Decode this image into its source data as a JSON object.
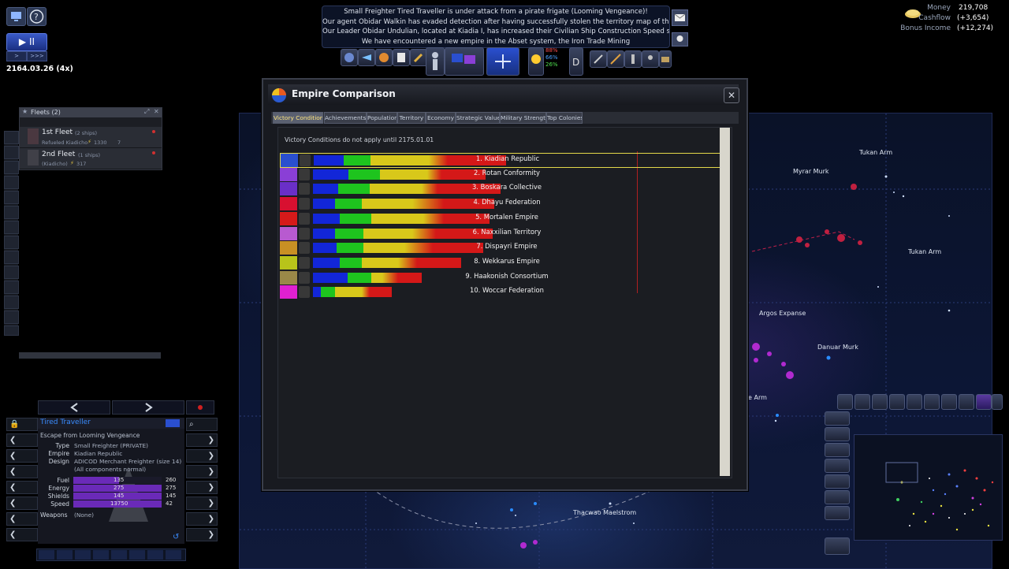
{
  "game": {
    "date": "2164.03.26 (4x)",
    "speed_play_label": "▶",
    "speed_pause_label": "II",
    "speed_prev_label": ">",
    "speed_next_label": ">>>"
  },
  "messages": [
    "Small Freighter Tired Traveller is under attack from a pirate frigate (Looming Vengeance)!",
    "Our agent Obidar Walkin has evaded detection after having successfully stolen the territory map of the Re",
    "Our Leader Obidar Undulian, located at Kiadia I, has increased their Civilian Ship Construction Speed skill leve",
    "We have encountered a new empire in the Abset system, the Iron Trade Mining"
  ],
  "finance": {
    "money_label": "Money",
    "money_value": "219,708",
    "cashflow_label": "Cashflow",
    "cashflow_value": "(+3,654)",
    "bonus_label": "Bonus Income",
    "bonus_value": "(+12,274)"
  },
  "toolbar": {
    "pct1": "88%",
    "pct2": "66%",
    "pct3": "26%"
  },
  "dialog": {
    "title": "Empire Comparison",
    "close_label": "✕",
    "tabs": [
      "Victory Conditions",
      "Achievements",
      "Population",
      "Territory",
      "Economy",
      "Strategic Value",
      "Military Strength",
      "Top Colonies"
    ],
    "active_tab": "Victory Conditions",
    "notice": "Victory Conditions do not apply until 2175.01.01",
    "empires": [
      {
        "name": "1. Kiadian Republic",
        "flag": "#2a4fcf",
        "bars": [
          38,
          34,
          30,
          44,
          24,
          74
        ],
        "selected": true
      },
      {
        "name": "2. Rotan Conformity",
        "flag": "#8a3fd6",
        "bars": [
          45,
          40,
          34,
          26,
          18,
          56
        ]
      },
      {
        "name": "3. Boskara Collective",
        "flag": "#6a2fc8",
        "bars": [
          32,
          40,
          36,
          30,
          20,
          80
        ]
      },
      {
        "name": "4. Dhayu Federation",
        "flag": "#d81030",
        "bars": [
          28,
          34,
          28,
          36,
          40,
          64
        ]
      },
      {
        "name": "5. Mortalen Empire",
        "flag": "#d61a1a",
        "bars": [
          34,
          40,
          40,
          26,
          26,
          58
        ]
      },
      {
        "name": "6. Naxxilian Territory",
        "flag": "#b85ad0",
        "bars": [
          28,
          36,
          30,
          32,
          30,
          72
        ]
      },
      {
        "name": "7. Dispayri Empire",
        "flag": "#c89024",
        "bars": [
          30,
          34,
          30,
          22,
          36,
          64
        ]
      },
      {
        "name": "8. Wekkarus Empire",
        "flag": "#b8c41a",
        "bars": [
          34,
          28,
          24,
          22,
          24,
          56
        ]
      },
      {
        "name": "9. Haakonish Consortium",
        "flag": "#9a8848",
        "bars": [
          44,
          30,
          8,
          6,
          20,
          30
        ]
      },
      {
        "name": "10. Woccar Federation",
        "flag": "#e020d0",
        "bars": [
          10,
          18,
          0,
          34,
          10,
          28
        ]
      }
    ]
  },
  "fleets": {
    "header": "Fleets (2)",
    "items": [
      {
        "name": "1st Fleet",
        "ships": "(2 ships)",
        "status": "Refueled Kiadicho",
        "fuel": "1330",
        "count": "7"
      },
      {
        "name": "2nd Fleet",
        "ships": "(1 ships)",
        "status": "(Kiadicho)",
        "fuel": "317",
        "count": ""
      }
    ]
  },
  "ship": {
    "name": "Tired Traveller",
    "mission": "Escape from Looming Vengeance",
    "type_label": "Type",
    "type_value": "Small Freighter (PRIVATE)",
    "empire_label": "Empire",
    "empire_value": "Kiadian Republic",
    "design_label": "Design",
    "design_value": "ADICOD Merchant Freighter (size 14)",
    "design_note": "(All components normal)",
    "stats": [
      {
        "label": "Fuel",
        "value": "135",
        "max": "260",
        "fraction": 0.52
      },
      {
        "label": "Energy",
        "value": "275",
        "max": "275",
        "fraction": 1.0
      },
      {
        "label": "Shields",
        "value": "145",
        "max": "145",
        "fraction": 1.0
      },
      {
        "label": "Speed",
        "value": "13750",
        "max": "42",
        "fraction": 1.0
      }
    ],
    "weapons_label": "Weapons",
    "weapons_value": "(None)"
  },
  "map_labels": [
    "Tukan Arm",
    "Myrar Murk",
    "Tukan Arm",
    "Argos Expanse",
    "Danuar Murk",
    "e Arm",
    "Thacwao Maelstrom"
  ],
  "colors": {
    "bar_blue": "#1226d8",
    "bar_green": "#1ec41e",
    "bar_yellow": "#d8c81a",
    "bar_red": "#d41818",
    "highlight": "#e3d84a"
  }
}
